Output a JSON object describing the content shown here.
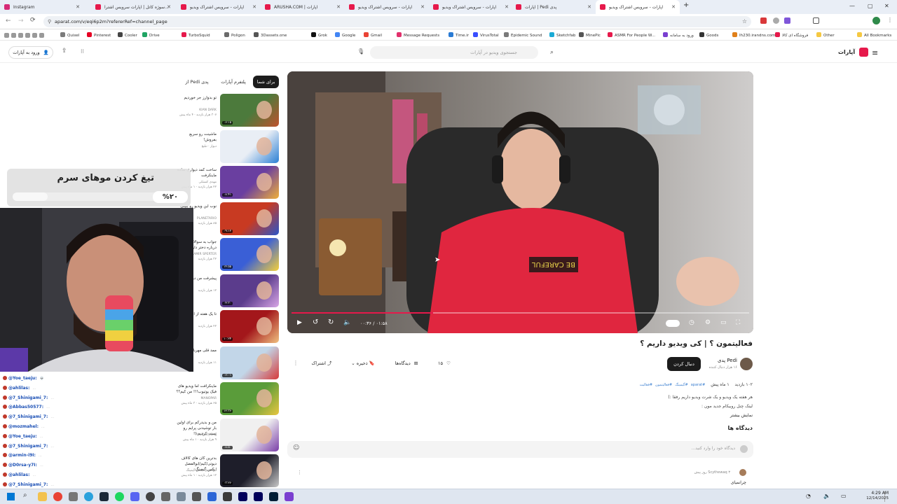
{
  "browser": {
    "tabs": [
      {
        "label": "Instagram",
        "color": "#d62976"
      },
      {
        "label": "سوژه کاتل | آپارات سرویس اشترا...",
        "color": "#e6194b"
      },
      {
        "label": "آپارات - سرویس اشتراک ویدیو",
        "color": "#e6194b"
      },
      {
        "label": "ARUSHA.COM | آپارات",
        "color": "#e6194b"
      },
      {
        "label": "آپارات - سرویس اشتراک ویدیو",
        "color": "#e6194b"
      },
      {
        "label": "آپارات - سرویس اشتراک ویدیو",
        "color": "#e6194b"
      },
      {
        "label": "آپارات | Pedi پدی",
        "color": "#e6194b"
      },
      {
        "label": "آپارات - سرویس اشتراک ویدیو",
        "color": "#e6194b"
      }
    ],
    "url": "aparat.com/v/eqi6p2m?refererRef=channel_page",
    "bookmarks": [
      "Quixel",
      "Pinterest",
      "Cooler",
      "Drive",
      "TurboSquid",
      "Poligon",
      "3Dassets.one",
      "Grok",
      "Google",
      "Gmail",
      "Message Requests",
      "Time.ir",
      "VirusTotal",
      "Epidemic Sound",
      "Sketchfab",
      "MinePic",
      "ASMR For People W...",
      "ورود به سامانه",
      "Goods",
      "Ih230.irandns.com",
      "فروشگاه ای کالا",
      "Other",
      "All Bookmarks"
    ]
  },
  "site": {
    "logo": "آپارات",
    "search_placeholder": "جستجوی ویدیو در آپارات",
    "login_label": "ورود به آپارات"
  },
  "player": {
    "time": "۰۰:۳۶ / ۰۱:۵۸",
    "progress": 0.31,
    "shirt_text": "BE CAREFUL"
  },
  "video": {
    "title": "فعالیتمون ؟ | کی ویدیو داریم ؟",
    "channel": "Pedi پدی",
    "subscribers": "۱۶ هزار دنبال کننده",
    "follow_label": "دنبال کردن",
    "likes": "۱۵",
    "playlist_label": "دیدگاه‌ها",
    "save_label": "ذخیره",
    "share_label": "اشتراک",
    "views": "۱۰۲ بازدید",
    "date": "۱ ماه پیش",
    "tags": [
      "#aparat",
      "#گیمینگ",
      "#فعالیتمون",
      "#فعالیت"
    ],
    "description_1": "هر هفته یک ویدیو و یک شرت ویدیو داریم رفقا :)",
    "description_2": "لینک چنل روبیکام جدید مون :",
    "show_more": "نمایش بیشتر",
    "comments_title": "دیدگاه ها",
    "comment_placeholder": "دیدگاه خود را وارد کنید...",
    "first_comment_author": "Scythewaq",
    "first_comment_time": "۳ روز پیش",
    "first_comment_text": "چرانمیای"
  },
  "sidebar": {
    "tabs": [
      "برای شما",
      "پلتفرم آپارات",
      "از Pedi پدی"
    ],
    "videos": [
      {
        "title": "تو بدوارز جر خوردیم",
        "meta": "KIAN DARK",
        "views": "۳۰۷ هزار بازدید · ۴ ماه پیش",
        "dur": "۰۶:۱۵",
        "c1": "#4c7a3c",
        "c2": "#c0522d"
      },
      {
        "title": "ماشینت رو سریع بفروش!",
        "meta": "دیوار · تبلیغ",
        "views": "",
        "dur": "",
        "c1": "#e9eef5",
        "c2": "#2a7fd4"
      },
      {
        "title": "ساخت کمد دیواری ساده ماینکرفت",
        "meta": "مهدی کشتکی",
        "views": "۲۲ هزار بازدید · ۱ ماه پیش",
        "dur": "۰۸:۴۱",
        "c1": "#6a3fa0",
        "c2": "#f0b03a"
      },
      {
        "title": "نوب این ویدیو رو ببینی",
        "meta": "PLANETARIO",
        "views": "۸۵ هزار بازدید",
        "dur": "۰۹:۱۲",
        "c1": "#c83a22",
        "c2": "#2a55c8"
      },
      {
        "title": "جواب به سوالات و درباره دختر داریم؟",
        "meta": "AMIR SPERTER",
        "views": "۳۲ هزار بازدید",
        "dur": "۱۴:۵۵",
        "c1": "#3a5fd6",
        "c2": "#f5d13a"
      },
      {
        "title": "پیشرفت من در اینستا",
        "meta": "",
        "views": "۱۲ هزار بازدید",
        "dur": "۰۴:۳۰",
        "c1": "#5b3c8c",
        "c2": "#d8a6e6"
      },
      {
        "title": "تا یک هفته از این ویدیو",
        "meta": "",
        "views": "۲۲ هزار بازدید",
        "dur": "۱۰:۲۴",
        "c1": "#a3171b",
        "c2": "#f0c080"
      },
      {
        "title": "ممد قلی مهربان",
        "meta": "",
        "views": "۱۱ هزار بازدید",
        "dur": "۰۶:۰۱",
        "c1": "#c2d6e8",
        "c2": "#d63a3a"
      },
      {
        "title": "ماینکرافت اما ویدیو های فیک یوتیوب!!! من کیم؟؟",
        "meta": "MANOPAR",
        "views": "۶۵ هزار بازدید · ۳ ماه پیش",
        "dur": "۱۲:۳۶",
        "c1": "#5a9c3a",
        "c2": "#e8c640"
      },
      {
        "title": "من و بدیدرکم برای اولین بار توشیدنی پرایم رو تست کردیم !!",
        "meta": "Abolfazl_King",
        "views": "۹ هزار بازدید · ۱ ماه پیش",
        "dur": "۰۸:۵۰",
        "c1": "#f0f0f0",
        "c2": "#7a3da8"
      },
      {
        "title": "بدترین کان های کالاف دیوتی/کیم/ابوالفضل ایکس گیمینگ",
        "meta": "ابوالفضل ایکس گیمینگ",
        "views": "۱۲ هزار بازدید · ۱ ماه پیش",
        "dur": "۰۳:۲۶",
        "c1": "#1e1e2a",
        "c2": "#c8c8c8"
      }
    ]
  },
  "overlay": {
    "banner_text": "تیغ کردن موهای سرم",
    "percent": "%۲۰",
    "percent_value": 20
  },
  "chat": [
    {
      "user": "@Yoe_taeju:",
      "msg": "💀"
    },
    {
      "user": "@ahlilas:",
      "msg": "..."
    },
    {
      "user": "@7_Shinigami_7:",
      "msg": "..."
    },
    {
      "user": "@Abbas50577:",
      "msg": "..."
    },
    {
      "user": "@7_Shinigami_7:",
      "msg": "..."
    },
    {
      "user": "@mozmahel:",
      "msg": "..."
    },
    {
      "user": "@Yoe_taeju:",
      "msg": "..."
    },
    {
      "user": "@7_Shinigami_7:",
      "msg": "..."
    },
    {
      "user": "@armin-i9I:",
      "msg": "..."
    },
    {
      "user": "@D0rsa-y7I:",
      "msg": "..."
    },
    {
      "user": "@ahlilas:",
      "msg": "..."
    },
    {
      "user": "@7_Shinigami_7:",
      "msg": "..."
    }
  ],
  "taskbar": {
    "time": "4:29 AM",
    "date": "12/14/2025"
  }
}
